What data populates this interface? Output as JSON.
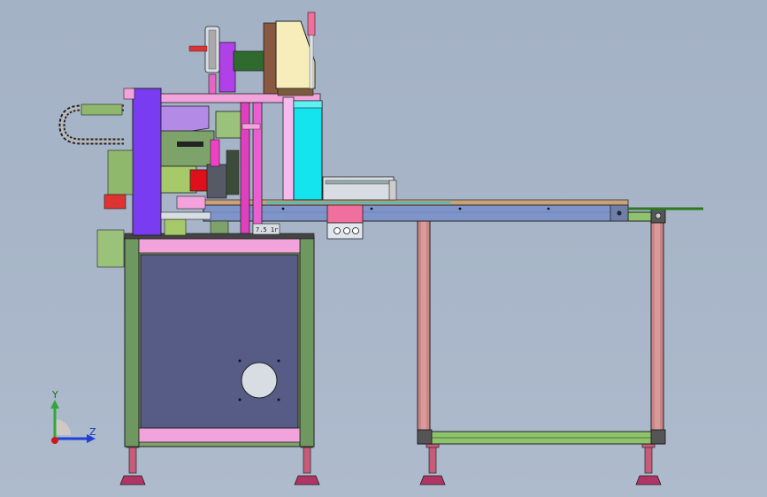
{
  "viewport": {
    "background_color": "#a8b5c8"
  },
  "machine_labels": {
    "plate_text": "7.5 1r"
  },
  "triad": {
    "y_label": "Y",
    "z_label": "Z",
    "y_color": "#2fa83a",
    "z_color": "#1f3fd6",
    "x_color": "#d01818"
  }
}
